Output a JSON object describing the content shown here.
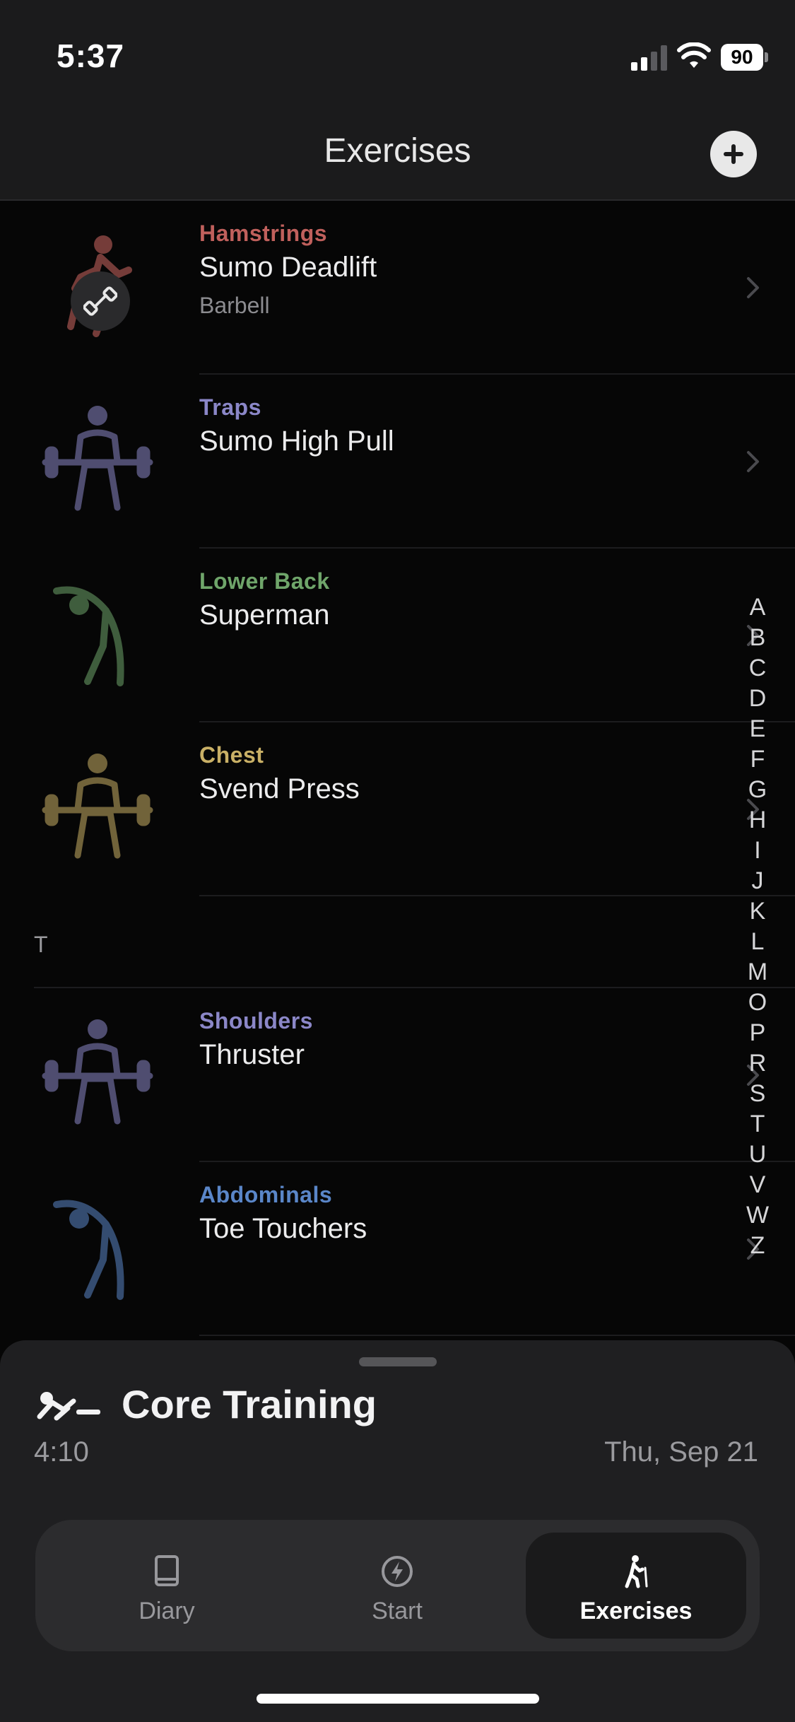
{
  "status": {
    "time": "5:37",
    "battery": "90"
  },
  "nav": {
    "title": "Exercises",
    "add_icon": "plus-circle-icon"
  },
  "exercises_before": [
    {
      "muscle": "Hamstrings",
      "name": "Sumo Deadlift",
      "equipment": "Barbell",
      "color": "#c0605c",
      "figure": "runner"
    },
    {
      "muscle": "Traps",
      "name": "Sumo High Pull",
      "equipment": "",
      "color": "#8b87c8",
      "figure": "barbell"
    },
    {
      "muscle": "Lower Back",
      "name": "Superman",
      "equipment": "",
      "color": "#6fa56a",
      "figure": "bend"
    },
    {
      "muscle": "Chest",
      "name": "Svend Press",
      "equipment": "",
      "color": "#c9b066",
      "figure": "barbell"
    }
  ],
  "section": {
    "label": "T"
  },
  "exercises_after": [
    {
      "muscle": "Shoulders",
      "name": "Thruster",
      "equipment": "",
      "color": "#8b87c8",
      "figure": "barbell"
    },
    {
      "muscle": "Abdominals",
      "name": "Toe Touchers",
      "equipment": "",
      "color": "#5a86c8",
      "figure": "bend"
    }
  ],
  "index_letters": [
    "A",
    "B",
    "C",
    "D",
    "E",
    "F",
    "G",
    "H",
    "I",
    "J",
    "K",
    "L",
    "M",
    "O",
    "P",
    "R",
    "S",
    "T",
    "U",
    "V",
    "W",
    "Z"
  ],
  "workout": {
    "title": "Core Training",
    "elapsed": "4:10",
    "date": "Thu, Sep 21"
  },
  "tabs": [
    {
      "label": "Diary",
      "icon": "book-icon"
    },
    {
      "label": "Start",
      "icon": "lightning-icon"
    },
    {
      "label": "Exercises",
      "icon": "hiker-icon",
      "active": true
    }
  ]
}
